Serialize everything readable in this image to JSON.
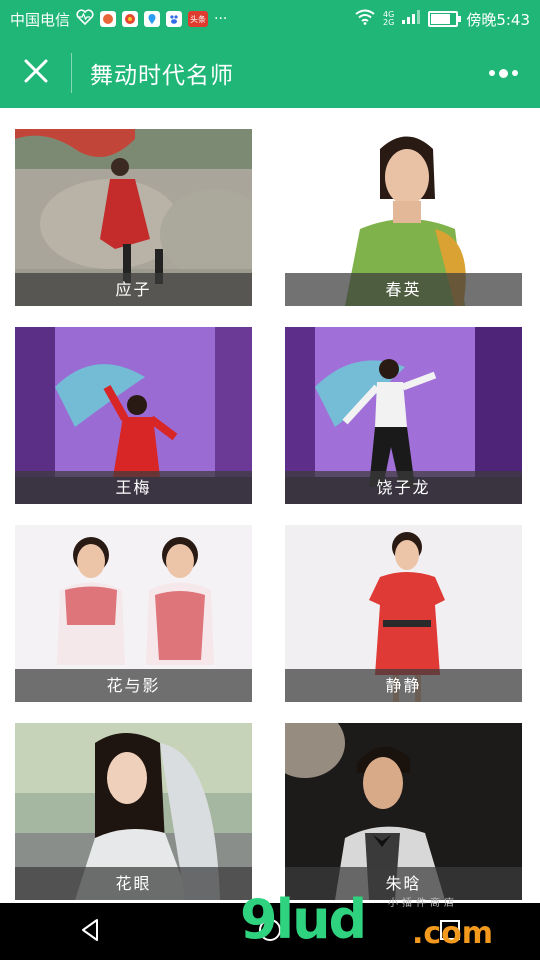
{
  "status_bar": {
    "carrier": "中国电信",
    "notification_icons": [
      "heart-rate-icon",
      "game-icon",
      "weibo-icon",
      "maps-icon",
      "baidu-icon",
      "toutiao-icon"
    ],
    "toutiao_label": "头条",
    "more": "···",
    "network": "4G",
    "network2": "2G",
    "time": "傍晚5:43",
    "battery_level": 0.7
  },
  "header": {
    "title": "舞动时代名师"
  },
  "teachers": [
    {
      "name": "应子"
    },
    {
      "name": "春英"
    },
    {
      "name": "王梅"
    },
    {
      "name": "饶子龙"
    },
    {
      "name": "花与影"
    },
    {
      "name": "静静"
    },
    {
      "name": "花眼"
    },
    {
      "name": "朱晗"
    }
  ],
  "watermark": {
    "main": "9lud",
    "domain": ".com",
    "tagline": "小插件商店"
  },
  "colors": {
    "brand_green": "#1fb677",
    "caption_bg": "#3c3c3c"
  }
}
